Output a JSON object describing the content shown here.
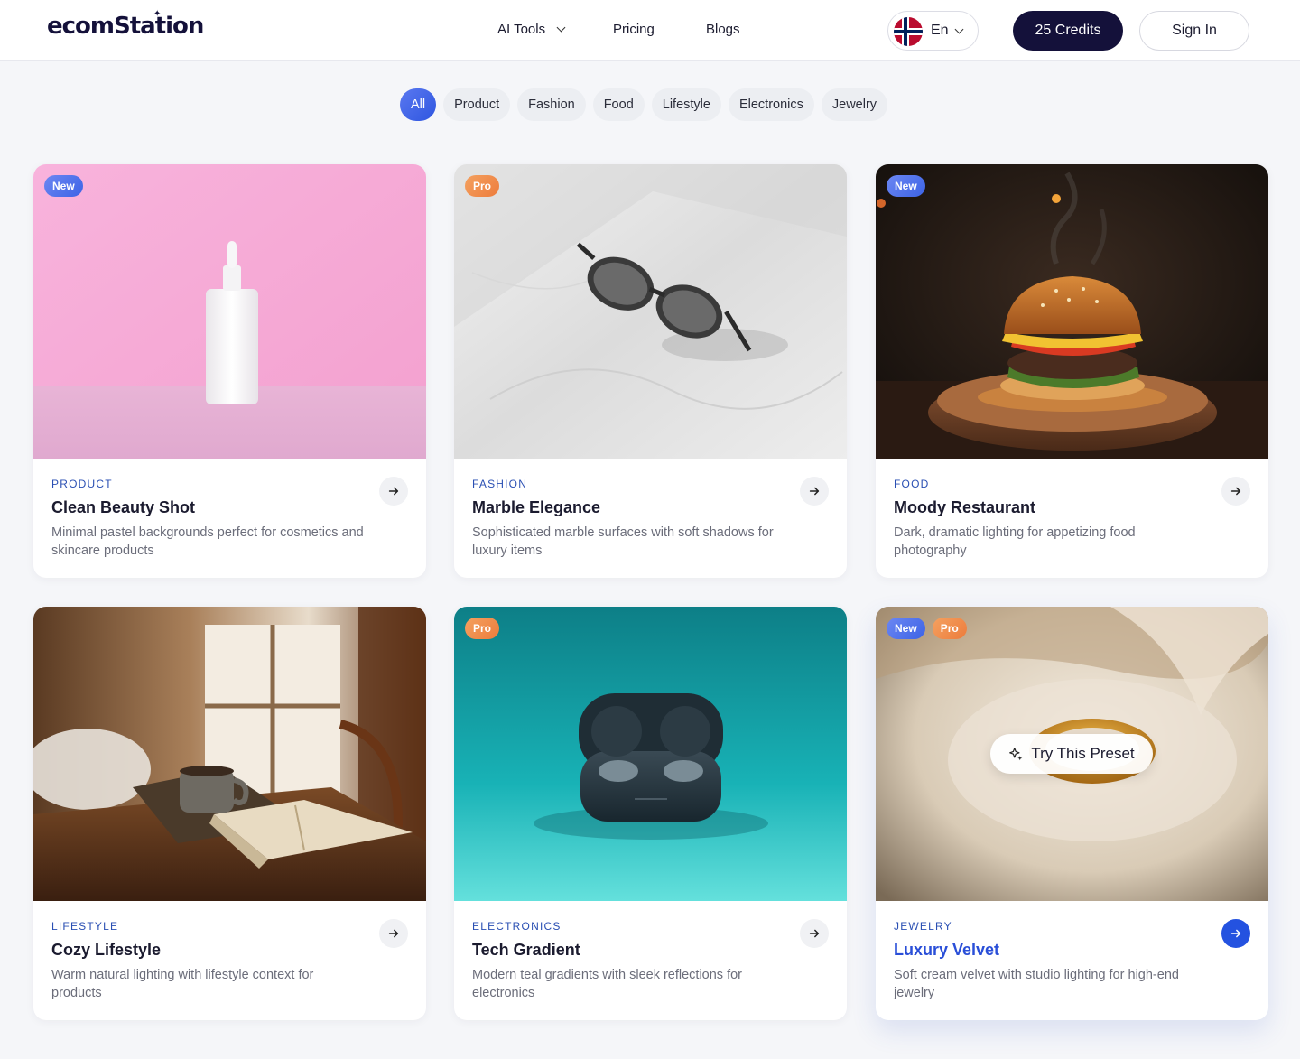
{
  "header": {
    "logo": "ecomStation",
    "nav": {
      "ai_tools": "AI Tools",
      "pricing": "Pricing",
      "blogs": "Blogs"
    },
    "language": "En",
    "credits": "25 Credits",
    "sign_in": "Sign In"
  },
  "filters": [
    "All",
    "Product",
    "Fashion",
    "Food",
    "Lifestyle",
    "Electronics",
    "Jewelry"
  ],
  "active_filter": "All",
  "cards": [
    {
      "badges": [
        "New"
      ],
      "category": "PRODUCT",
      "title": "Clean Beauty Shot",
      "description": "Minimal pastel backgrounds perfect for cosmetics and skincare products"
    },
    {
      "badges": [
        "Pro"
      ],
      "category": "FASHION",
      "title": "Marble Elegance",
      "description": "Sophisticated marble surfaces with soft shadows for luxury items"
    },
    {
      "badges": [
        "New"
      ],
      "category": "FOOD",
      "title": "Moody Restaurant",
      "description": "Dark, dramatic lighting for appetizing food photography"
    },
    {
      "badges": [],
      "category": "LIFESTYLE",
      "title": "Cozy Lifestyle",
      "description": "Warm natural lighting with lifestyle context for products"
    },
    {
      "badges": [
        "Pro"
      ],
      "category": "ELECTRONICS",
      "title": "Tech Gradient",
      "description": "Modern teal gradients with sleek reflections for electronics"
    },
    {
      "badges": [
        "New",
        "Pro"
      ],
      "category": "JEWELRY",
      "title": "Luxury Velvet",
      "description": "Soft cream velvet with studio lighting for high-end jewelry",
      "hover_label": "Try This Preset"
    }
  ],
  "colors": {
    "brand": "#14113a",
    "accent": "#2e56e0",
    "new_badge": "#4a6ce8",
    "pro_badge": "#ef8444"
  }
}
